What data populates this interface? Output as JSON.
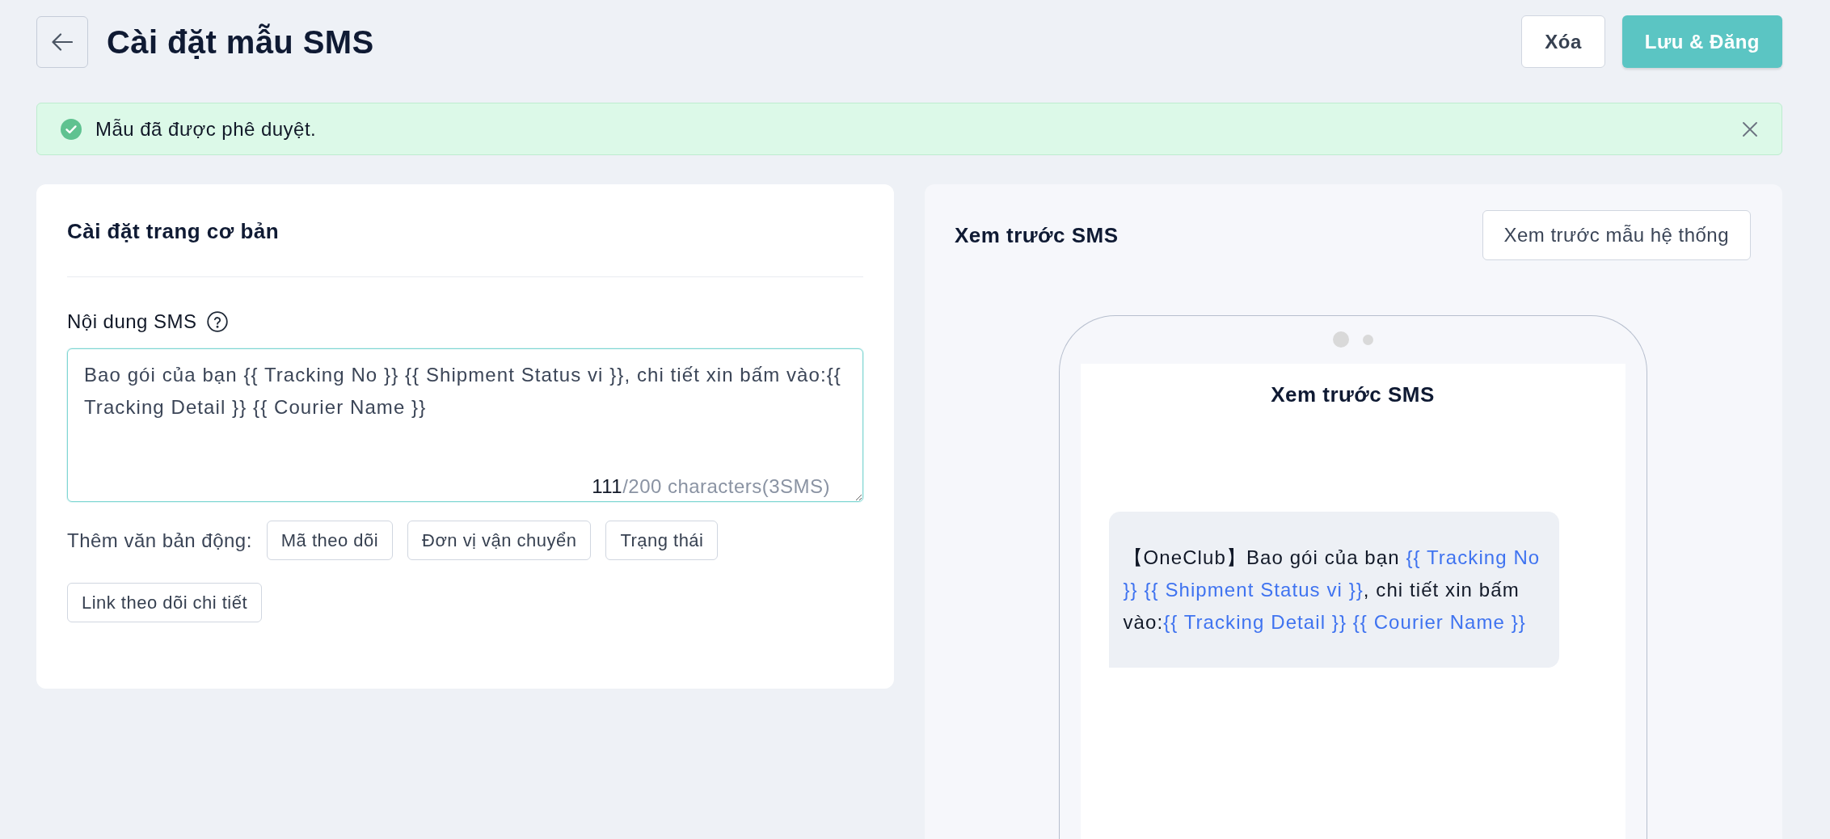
{
  "header": {
    "title": "Cài đặt mẫu SMS",
    "buttons": [
      {
        "label": "Xóa",
        "kind": "secondary"
      },
      {
        "label": "Lưu & Đăng",
        "kind": "primary"
      }
    ]
  },
  "alert": {
    "kind": "success",
    "message": "Mẫu đã được phê duyệt."
  },
  "settings_card": {
    "title": "Cài đặt trang cơ bản",
    "field": {
      "label": "Nội dung SMS",
      "value": "Bao gói của bạn {{ Tracking No }} {{ Shipment Status vi }}, chi tiết xin bấm vào:{{ Tracking Detail }} {{ Courier Name }}",
      "focused": true,
      "count": "111",
      "limit": "/200 characters(3SMS)"
    },
    "dynamic_text": {
      "label": "Thêm văn bản động:",
      "chips": [
        "Mã theo dõi",
        "Đơn vị vận chuyển",
        "Trạng thái",
        "Link theo dõi chi tiết"
      ]
    }
  },
  "preview": {
    "title": "Xem trước SMS",
    "button": "Xem trước mẫu hệ thống",
    "phone": {
      "title": "Xem trước SMS",
      "message": [
        {
          "kind": "text",
          "text": "【OneClub】Bao gói của bạn "
        },
        {
          "kind": "variable",
          "text": "{{ Tracking No }} {{ Shipment Status vi }}"
        },
        {
          "kind": "text",
          "text": ", chi tiết xin bấm vào:"
        },
        {
          "kind": "variable",
          "text": "{{ Tracking Detail }} {{ Courier Name }}"
        }
      ]
    }
  }
}
